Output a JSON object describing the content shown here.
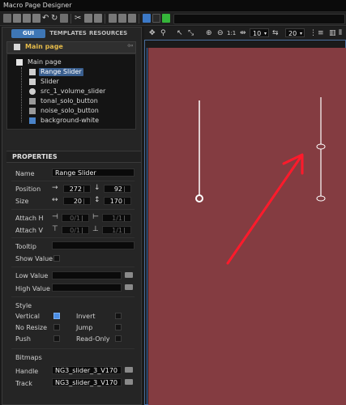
{
  "window": {
    "title": "Macro Page Designer"
  },
  "toolbar": {
    "icons": [
      "new-icon",
      "open-icon",
      "save-icon",
      "import-icon",
      "undo-icon",
      "redo-icon",
      "delete-icon",
      "cut-icon",
      "copy-icon",
      "paste-icon",
      "group-icon",
      "ungroup-icon",
      "panel-icon",
      "image-icon",
      "play-icon"
    ],
    "play_color": "#35b53a"
  },
  "left_panel": {
    "tabs": [
      "GUI",
      "TEMPLATES",
      "RESOURCES"
    ],
    "active_tab": "GUI",
    "main_page_title": "Main page",
    "tree": {
      "root": "Main page",
      "items": [
        "Range Slider",
        "Slider",
        "src_1_volume_slider",
        "tonal_solo_button",
        "noise_solo_button",
        "background-white"
      ],
      "selected": "Range Slider"
    }
  },
  "properties": {
    "header": "PROPERTIES",
    "name_label": "Name",
    "name_value": "Range Slider",
    "position_label": "Position",
    "position_x": "272",
    "position_y": "92",
    "size_label": "Size",
    "size_w": "20",
    "size_h": "170",
    "attach_h_label": "Attach H",
    "attach_h_a": "0/1",
    "attach_h_b": "1/1",
    "attach_v_label": "Attach V",
    "attach_v_a": "0/1",
    "attach_v_b": "1/1",
    "tooltip_label": "Tooltip",
    "show_value_label": "Show Value",
    "low_value_label": "Low Value",
    "high_value_label": "High Value",
    "style_label": "Style",
    "vertical_label": "Vertical",
    "vertical_checked": true,
    "invert_label": "Invert",
    "no_resize_label": "No Resize",
    "jump_label": "Jump",
    "push_label": "Push",
    "read_only_label": "Read-Only",
    "bitmaps_label": "Bitmaps",
    "handle_label": "Handle",
    "handle_value": "NG3_slider_3_V170",
    "track_label": "Track",
    "track_value": "NG3_slider_3_V170"
  },
  "canvas_toolbar": {
    "zoom_label": "1:1",
    "grid_x_value": "10",
    "grid_y_value": "20"
  },
  "canvas": {
    "background": "#843c41",
    "annotation_arrow_color": "#ff1a2b"
  }
}
